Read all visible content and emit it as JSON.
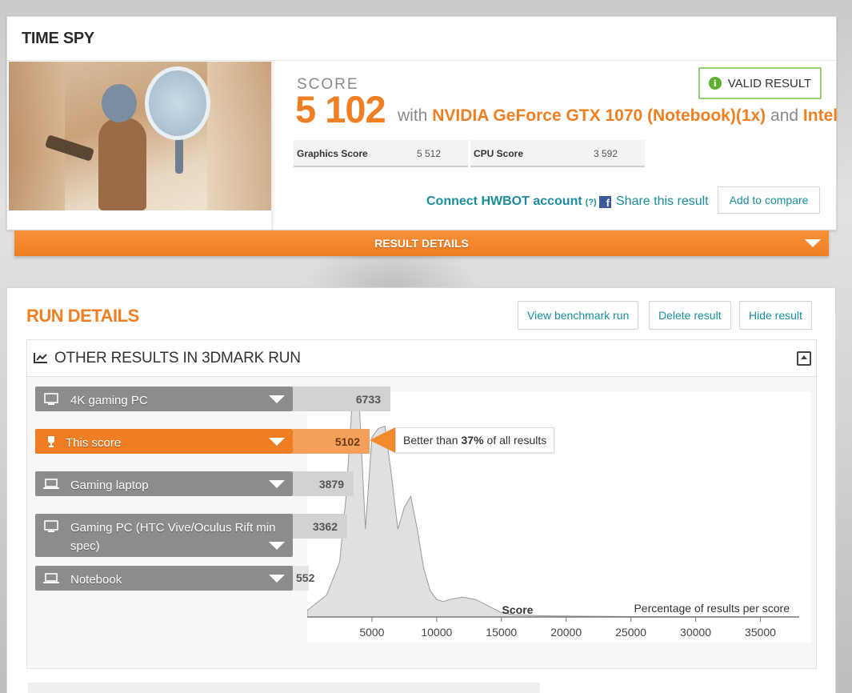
{
  "test": {
    "title": "TIME SPY",
    "score_label": "SCORE",
    "score_value": "5 102",
    "with_text": "with",
    "gpu": "NVIDIA GeForce GTX 1070 (Notebook)(1x)",
    "and_text": "and",
    "cpu": "Intel",
    "valid_badge": "VALID RESULT",
    "graphics_score_label": "Graphics Score",
    "graphics_score_value": "5 512",
    "cpu_score_label": "CPU Score",
    "cpu_score_value": "3 592",
    "hwbot_link": "Connect HWBOT account",
    "hwbot_help": "(?)",
    "share_link": "Share this result",
    "compare_button": "Add to compare",
    "result_details_bar": "RESULT DETAILS"
  },
  "run_details": {
    "title": "RUN DETAILS",
    "buttons": {
      "view": "View benchmark run",
      "delete": "Delete result",
      "hide": "Hide result"
    },
    "other_results_title": "OTHER RESULTS IN 3DMARK RUN",
    "rows": [
      {
        "label": "4K gaming PC",
        "value": "6733",
        "icon": "desktop-icon",
        "highlight": false
      },
      {
        "label": "This score",
        "value": "5102",
        "icon": "trophy-icon",
        "highlight": true
      },
      {
        "label": "Gaming laptop",
        "value": "3879",
        "icon": "laptop-icon",
        "highlight": false
      },
      {
        "label": "Gaming PC (HTC Vive/Oculus Rift min spec)",
        "value": "3362",
        "icon": "desktop-icon",
        "highlight": false
      },
      {
        "label": "Notebook",
        "value": "552",
        "icon": "laptop-icon",
        "highlight": false
      }
    ],
    "better_than": {
      "prefix": "Better than",
      "percent": "37%",
      "suffix": "of all results"
    }
  },
  "chart_data": {
    "type": "area",
    "title": "",
    "xlabel": "Score",
    "ylabel": "Percentage of results per score",
    "xlim": [
      0,
      38000
    ],
    "x_ticks": [
      5000,
      10000,
      15000,
      20000,
      25000,
      30000,
      35000
    ],
    "tick_labels": [
      "5000",
      "10000",
      "15000",
      "20000",
      "25000",
      "30000",
      "35000"
    ],
    "x": [
      0,
      1500,
      2500,
      3000,
      3500,
      4000,
      4500,
      5000,
      5500,
      6000,
      6500,
      7000,
      7500,
      8000,
      8500,
      9000,
      9500,
      10000,
      10500,
      11000,
      12000,
      13000,
      14000,
      15000,
      16000,
      18000,
      20000,
      25000,
      30000,
      35000
    ],
    "values": [
      3,
      10,
      25,
      55,
      100,
      100,
      40,
      82,
      86,
      87,
      65,
      40,
      50,
      55,
      40,
      22,
      12,
      8,
      7,
      8,
      9,
      8,
      5,
      2,
      1,
      0.6,
      0.4,
      0.2,
      0.1,
      0.05
    ],
    "color": "#e0e0e0",
    "marker_score": 5102,
    "grid": false
  }
}
